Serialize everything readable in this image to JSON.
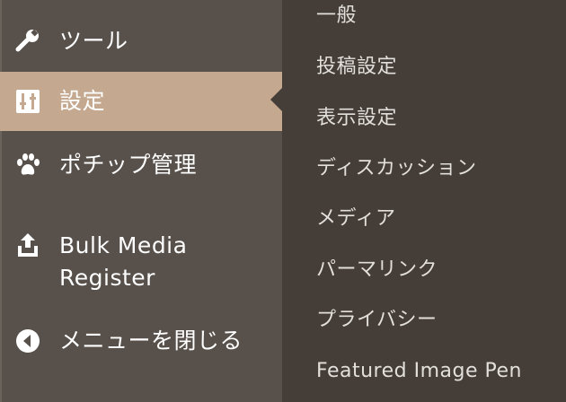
{
  "sidebar": {
    "items": [
      {
        "label": "ツール",
        "icon": "wrench-icon"
      },
      {
        "label": "設定",
        "icon": "sliders-icon",
        "active": true
      },
      {
        "label": "ポチップ管理",
        "icon": "paw-icon"
      },
      {
        "label_line1": "Bulk Media",
        "label_line2": "Register",
        "icon": "upload-icon"
      },
      {
        "label": "メニューを閉じる",
        "icon": "collapse-arrow-icon"
      }
    ]
  },
  "submenu": {
    "items": [
      "一般",
      "投稿設定",
      "表示設定",
      "ディスカッション",
      "メディア",
      "パーマリンク",
      "プライバシー",
      "Featured Image Pen"
    ]
  },
  "colors": {
    "sidebar_bg": "#58514b",
    "active_bg": "#c4a88f",
    "submenu_bg": "#443d38",
    "text": "#ffffff",
    "submenu_text": "#e3dfdb"
  }
}
